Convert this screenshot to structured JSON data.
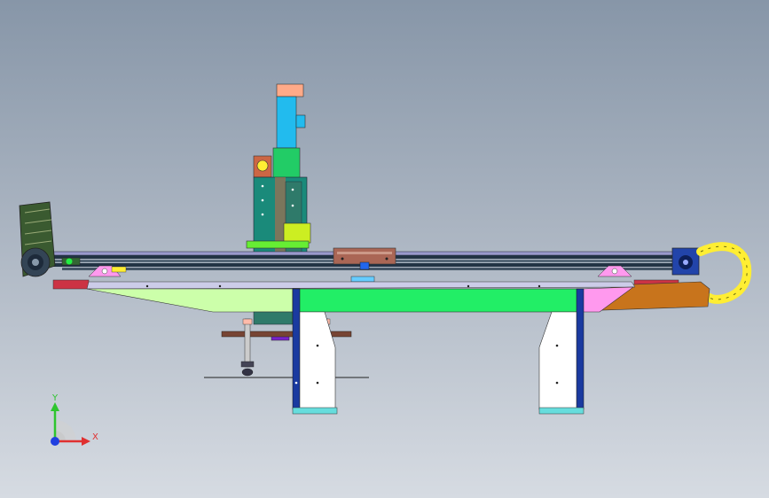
{
  "triad": {
    "y_label": "Y",
    "x_label": "X",
    "y_color": "#2ec52e",
    "x_color": "#e03030",
    "z_color": "#2040e0"
  },
  "colors": {
    "background_top": "#8796a8",
    "background_bottom": "#d6dbe2",
    "main_beam": "#22ee66",
    "beam_left_wedge": "#ccffaa",
    "beam_right_wedge": "#ff99ee",
    "leg_frame": "#1a3aa0",
    "leg_panel": "#ffffff",
    "leg_foot": "#66dddd",
    "rail": "#223344",
    "rail_top": "#9999cc",
    "tail_plate": "#c8741c",
    "cable_chain": "#ffee33",
    "vertical_axis_blue": "#22bbee",
    "vertical_axis_green": "#22cc66",
    "column_teal": "#1a8a7a",
    "motor_body": "#3a5a30",
    "carriage_brown": "#aa6655",
    "bracket_yellow_green": "#ccee22",
    "bracket_lime": "#66ee33",
    "gripper_plate": "#774433",
    "gripper_purple": "#7722cc",
    "drive_blue": "#2244aa",
    "tip_salmon": "#ffaa88"
  }
}
